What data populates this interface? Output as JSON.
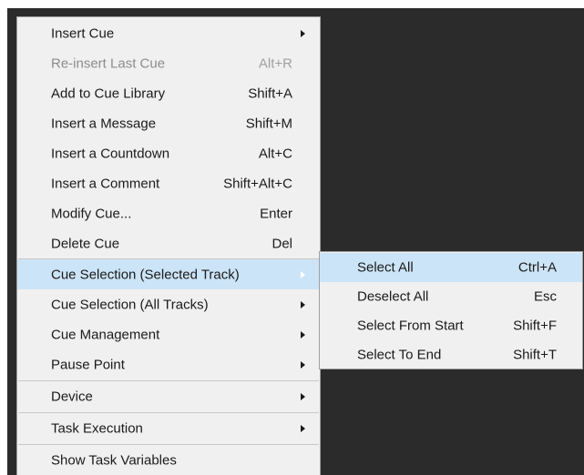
{
  "main_menu": {
    "items": [
      {
        "label": "Insert Cue",
        "shortcut": "",
        "submenu": true
      },
      {
        "label": "Re-insert Last Cue",
        "shortcut": "Alt+R",
        "disabled": true
      },
      {
        "label": "Add to Cue Library",
        "shortcut": "Shift+A"
      },
      {
        "label": "Insert a Message",
        "shortcut": "Shift+M"
      },
      {
        "label": "Insert a Countdown",
        "shortcut": "Alt+C"
      },
      {
        "label": "Insert a Comment",
        "shortcut": "Shift+Alt+C"
      },
      {
        "label": "Modify Cue...",
        "shortcut": "Enter"
      },
      {
        "label": "Delete Cue",
        "shortcut": "Del"
      },
      {
        "label": "Cue Selection (Selected Track)",
        "shortcut": "",
        "submenu": true,
        "highlighted": true
      },
      {
        "label": "Cue Selection (All Tracks)",
        "shortcut": "",
        "submenu": true
      },
      {
        "label": "Cue Management",
        "shortcut": "",
        "submenu": true
      },
      {
        "label": "Pause Point",
        "shortcut": "",
        "submenu": true
      },
      {
        "label": "Device",
        "shortcut": "",
        "submenu": true
      },
      {
        "label": "Task Execution",
        "shortcut": "",
        "submenu": true
      },
      {
        "label": "Show Task Variables",
        "shortcut": ""
      }
    ]
  },
  "sub_menu": {
    "items": [
      {
        "label": "Select All",
        "shortcut": "Ctrl+A",
        "highlighted": true
      },
      {
        "label": "Deselect All",
        "shortcut": "Esc"
      },
      {
        "label": "Select From Start",
        "shortcut": "Shift+F"
      },
      {
        "label": "Select To End",
        "shortcut": "Shift+T"
      }
    ]
  },
  "colors": {
    "menu_bg": "#f0f0f0",
    "highlight": "#cce4f7",
    "disabled_text": "#8c8c8c",
    "backdrop": "#2b2b2b"
  }
}
